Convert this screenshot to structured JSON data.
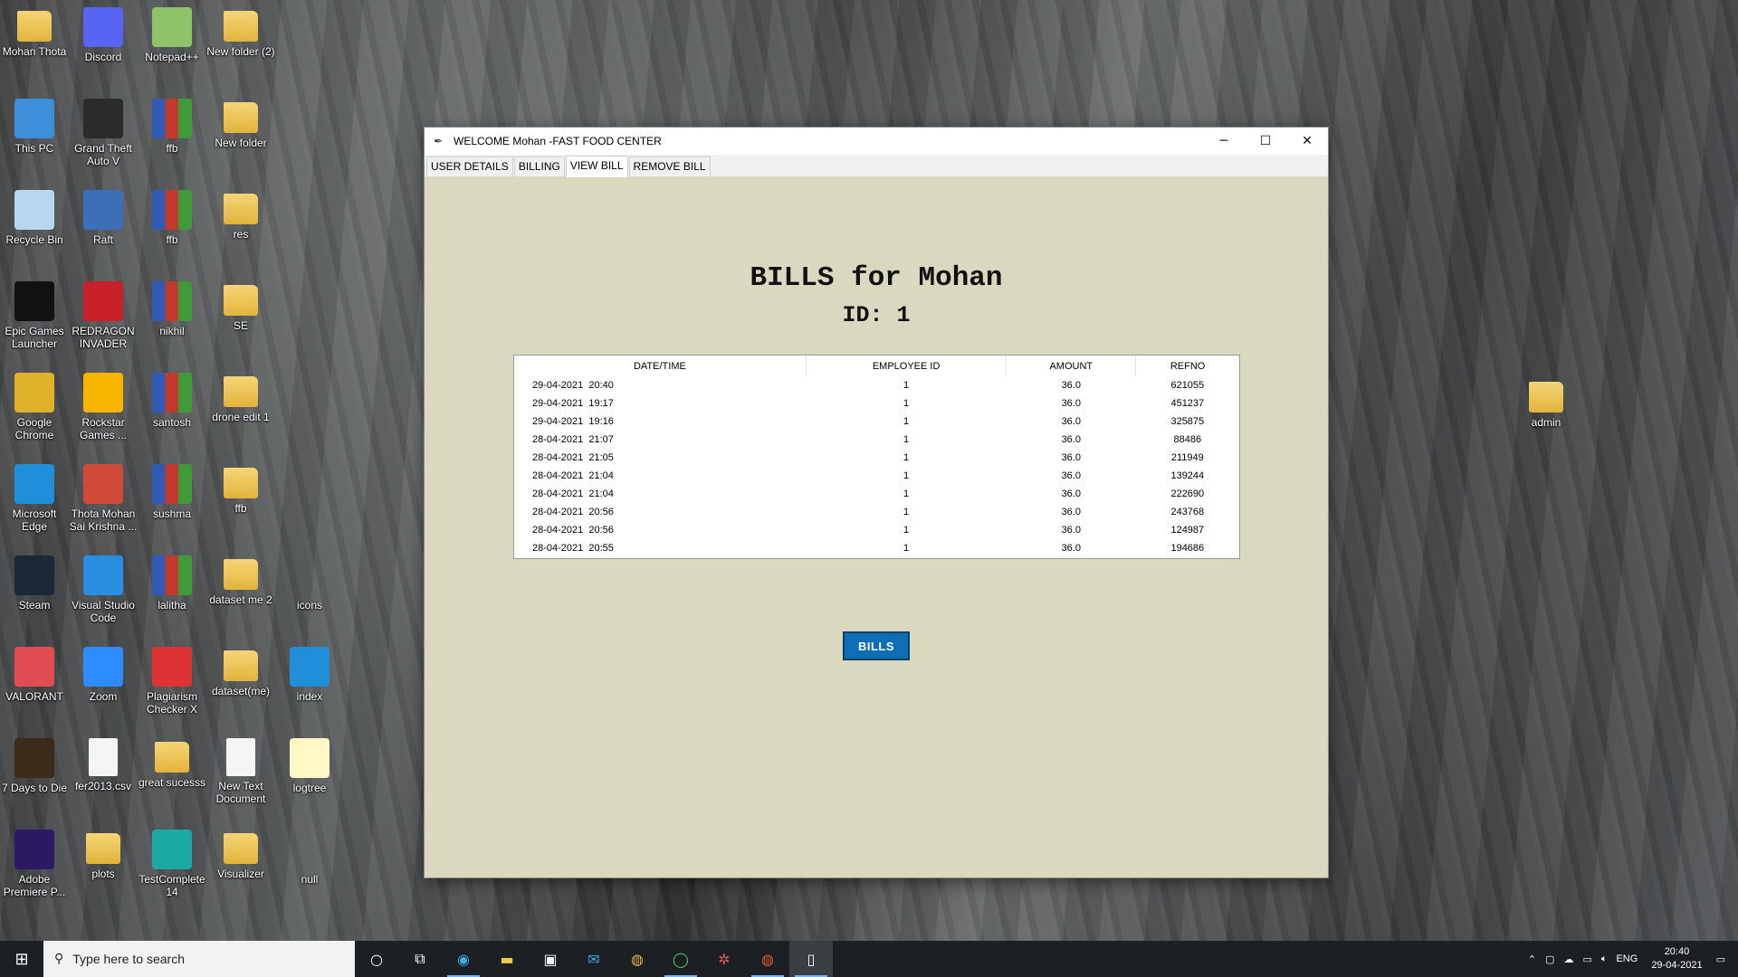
{
  "desktop": {
    "icons": [
      {
        "label": "Mohan Thota",
        "icon": "user-folder-icon",
        "col": 0,
        "row": 0
      },
      {
        "label": "Discord",
        "icon": "discord-icon",
        "col": 1,
        "row": 0
      },
      {
        "label": "Notepad++",
        "icon": "notepadpp-icon",
        "col": 2,
        "row": 0
      },
      {
        "label": "New folder (2)",
        "icon": "folder-icon",
        "col": 3,
        "row": 0
      },
      {
        "label": "This PC",
        "icon": "computer-icon",
        "col": 0,
        "row": 1
      },
      {
        "label": "Grand Theft Auto V",
        "icon": "gta-icon",
        "col": 1,
        "row": 1
      },
      {
        "label": "ffb",
        "icon": "archive-icon",
        "col": 2,
        "row": 1
      },
      {
        "label": "New folder",
        "icon": "folder-icon",
        "col": 3,
        "row": 1
      },
      {
        "label": "Recycle Bin",
        "icon": "recycle-bin-icon",
        "col": 0,
        "row": 2
      },
      {
        "label": "Raft",
        "icon": "raft-icon",
        "col": 1,
        "row": 2
      },
      {
        "label": "ffb",
        "icon": "archive-icon",
        "col": 2,
        "row": 2
      },
      {
        "label": "res",
        "icon": "folder-icon",
        "col": 3,
        "row": 2
      },
      {
        "label": "Epic Games Launcher",
        "icon": "epic-games-icon",
        "col": 0,
        "row": 3
      },
      {
        "label": "REDRAGON INVADER",
        "icon": "redragon-icon",
        "col": 1,
        "row": 3
      },
      {
        "label": "nikhil",
        "icon": "archive-icon",
        "col": 2,
        "row": 3
      },
      {
        "label": "SE",
        "icon": "folder-icon",
        "col": 3,
        "row": 3
      },
      {
        "label": "Google Chrome",
        "icon": "chrome-icon",
        "col": 0,
        "row": 4
      },
      {
        "label": "Rockstar Games ...",
        "icon": "rockstar-icon",
        "col": 1,
        "row": 4
      },
      {
        "label": "santosh",
        "icon": "archive-icon",
        "col": 2,
        "row": 4
      },
      {
        "label": "drone edit 1",
        "icon": "folder-icon",
        "col": 3,
        "row": 4
      },
      {
        "label": "Microsoft Edge",
        "icon": "edge-icon",
        "col": 0,
        "row": 5
      },
      {
        "label": "Thota Mohan Sai Krishna ...",
        "icon": "chrome-profile-icon",
        "col": 1,
        "row": 5
      },
      {
        "label": "sushma",
        "icon": "archive-icon",
        "col": 2,
        "row": 5
      },
      {
        "label": "ffb",
        "icon": "folder-icon",
        "col": 3,
        "row": 5
      },
      {
        "label": "Steam",
        "icon": "steam-icon",
        "col": 0,
        "row": 6
      },
      {
        "label": "Visual Studio Code",
        "icon": "vscode-icon",
        "col": 1,
        "row": 6
      },
      {
        "label": "lalitha",
        "icon": "archive-icon",
        "col": 2,
        "row": 6
      },
      {
        "label": "dataset me 2",
        "icon": "folder-icon",
        "col": 3,
        "row": 6
      },
      {
        "label": "icons",
        "icon": "blank-icon",
        "col": 4,
        "row": 6
      },
      {
        "label": "VALORANT",
        "icon": "valorant-icon",
        "col": 0,
        "row": 7
      },
      {
        "label": "Zoom",
        "icon": "zoom-icon",
        "col": 1,
        "row": 7
      },
      {
        "label": "Plagiarism Checker X",
        "icon": "plagiarism-icon",
        "col": 2,
        "row": 7
      },
      {
        "label": "dataset(me)",
        "icon": "folder-icon",
        "col": 3,
        "row": 7
      },
      {
        "label": "index",
        "icon": "edge-icon",
        "col": 4,
        "row": 7
      },
      {
        "label": "7 Days to Die",
        "icon": "7days-icon",
        "col": 0,
        "row": 8
      },
      {
        "label": "fer2013.csv",
        "icon": "file-icon",
        "col": 1,
        "row": 8
      },
      {
        "label": "great sucesss",
        "icon": "folder-icon",
        "col": 2,
        "row": 8
      },
      {
        "label": "New Text Document",
        "icon": "text-file-icon",
        "col": 3,
        "row": 8
      },
      {
        "label": "logtree",
        "icon": "python-file-icon",
        "col": 4,
        "row": 8
      },
      {
        "label": "Adobe Premiere P...",
        "icon": "premiere-icon",
        "col": 0,
        "row": 9
      },
      {
        "label": "plots",
        "icon": "folder-icon",
        "col": 1,
        "row": 9
      },
      {
        "label": "TestComplete 14",
        "icon": "testcomplete-icon",
        "col": 2,
        "row": 9
      },
      {
        "label": "Visualizer",
        "icon": "folder-icon",
        "col": 3,
        "row": 9
      },
      {
        "label": "null",
        "icon": "blank-icon",
        "col": 4,
        "row": 9
      }
    ],
    "right_icon": {
      "label": "admin",
      "icon": "zip-folder-icon"
    }
  },
  "window": {
    "title": "WELCOME Mohan -FAST FOOD CENTER",
    "controls": {
      "minimize": "─",
      "maximize": "☐",
      "close": "✕"
    },
    "tabs": [
      "USER DETAILS",
      "BILLING",
      "VIEW BILL",
      "REMOVE BILL"
    ],
    "active_tab": "VIEW BILL",
    "heading": "BILLS for Mohan",
    "subheading": "ID: 1",
    "table": {
      "columns": [
        "DATE/TIME",
        "EMPLOYEE ID",
        "AMOUNT",
        "REFNO"
      ],
      "rows": [
        [
          "29-04-2021  20:40",
          "1",
          "36.0",
          "621055"
        ],
        [
          "29-04-2021  19:17",
          "1",
          "36.0",
          "451237"
        ],
        [
          "29-04-2021  19:16",
          "1",
          "36.0",
          "325875"
        ],
        [
          "28-04-2021  21:07",
          "1",
          "36.0",
          "88486"
        ],
        [
          "28-04-2021  21:05",
          "1",
          "36.0",
          "211949"
        ],
        [
          "28-04-2021  21:04",
          "1",
          "36.0",
          "139244"
        ],
        [
          "28-04-2021  21:04",
          "1",
          "36.0",
          "222690"
        ],
        [
          "28-04-2021  20:56",
          "1",
          "36.0",
          "243768"
        ],
        [
          "28-04-2021  20:56",
          "1",
          "36.0",
          "124987"
        ],
        [
          "28-04-2021  20:55",
          "1",
          "36.0",
          "194686"
        ]
      ]
    },
    "bills_button": "BILLS"
  },
  "taskbar": {
    "search_placeholder": "Type here to search",
    "apps": [
      "cortana-icon",
      "task-view-icon",
      "edge-icon",
      "file-explorer-icon",
      "store-icon",
      "mail-icon",
      "chrome-icon",
      "circle-app-icon",
      "settings-gear-icon",
      "chrome-profile-icon",
      "tkinter-window-icon"
    ],
    "language": "ENG",
    "time": "20:40",
    "date": "29-04-2021"
  }
}
